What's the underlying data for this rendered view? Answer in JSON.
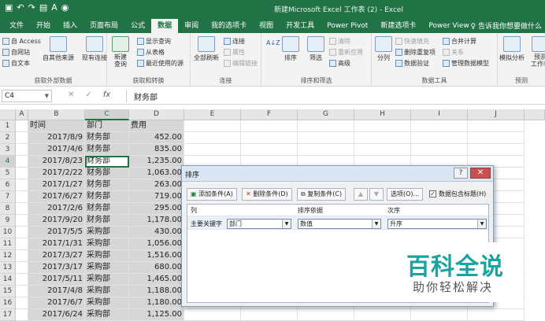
{
  "window": {
    "title": "新建Microsoft Excel 工作表 (2)  -  Excel",
    "qat_icons": [
      "save-icon",
      "undo-icon",
      "redo-icon",
      "print-preview-icon",
      "font-icon",
      "camera-icon"
    ]
  },
  "tabs": [
    {
      "label": "文件"
    },
    {
      "label": "开始"
    },
    {
      "label": "插入"
    },
    {
      "label": "页面布局"
    },
    {
      "label": "公式"
    },
    {
      "label": "数据",
      "active": true
    },
    {
      "label": "审阅"
    },
    {
      "label": "我的选项卡"
    },
    {
      "label": "视图"
    },
    {
      "label": "开发工具"
    },
    {
      "label": "Power Pivot"
    },
    {
      "label": "新建选项卡"
    },
    {
      "label": "Power View"
    }
  ],
  "tell_me": "♀ 告诉我你想要做什么",
  "ribbon": {
    "get_external": {
      "label": "获取外部数据",
      "items": [
        "自 Access",
        "自网站",
        "自文本",
        "自其他来源",
        "现有连接"
      ]
    },
    "get_transform": {
      "label": "获取和转换",
      "new_query": "新建\n查询",
      "items": [
        "显示查询",
        "从表格",
        "最近使用的源"
      ]
    },
    "connections": {
      "label": "连接",
      "refresh_all": "全部刷新",
      "items": [
        "连接",
        "属性",
        "编辑链接"
      ]
    },
    "sort_filter": {
      "label": "排序和筛选",
      "sort_az": "A↓Z",
      "sort": "排序",
      "filter": "筛选",
      "items": [
        "清除",
        "重新应用",
        "高级"
      ]
    },
    "data_tools": {
      "label": "数据工具",
      "split": "分列",
      "items": [
        "快速填充",
        "删除重复项",
        "数据验证",
        "合并计算",
        "关系",
        "管理数据模型"
      ]
    },
    "forecast": {
      "label": "预测",
      "items": [
        "模拟分析",
        "预测\n工作表"
      ]
    }
  },
  "formula_bar": {
    "name_box": "C4",
    "buttons": [
      "✕",
      "✓",
      "fx"
    ],
    "content": "财务部"
  },
  "grid": {
    "columns": [
      "A",
      "B",
      "C",
      "D",
      "E",
      "F",
      "G",
      "H",
      "I",
      "J"
    ],
    "rows": [
      {
        "num": "1",
        "b": "时间",
        "c": "部门",
        "d": "费用"
      },
      {
        "num": "2",
        "b": "2017/8/9",
        "c": "财务部",
        "d": "452.00"
      },
      {
        "num": "3",
        "b": "2017/4/6",
        "c": "财务部",
        "d": "835.00"
      },
      {
        "num": "4",
        "b": "2017/8/23",
        "c": "财务部",
        "d": "1,235.00"
      },
      {
        "num": "5",
        "b": "2017/2/22",
        "c": "财务部",
        "d": "1,063.00"
      },
      {
        "num": "6",
        "b": "2017/1/27",
        "c": "财务部",
        "d": "263.00"
      },
      {
        "num": "7",
        "b": "2017/6/27",
        "c": "财务部",
        "d": "719.00"
      },
      {
        "num": "8",
        "b": "2017/2/6",
        "c": "财务部",
        "d": "295.00"
      },
      {
        "num": "9",
        "b": "2017/9/20",
        "c": "财务部",
        "d": "1,178.00"
      },
      {
        "num": "10",
        "b": "2017/5/5",
        "c": "采购部",
        "d": "430.00"
      },
      {
        "num": "11",
        "b": "2017/1/31",
        "c": "采购部",
        "d": "1,056.00"
      },
      {
        "num": "12",
        "b": "2017/3/27",
        "c": "采购部",
        "d": "1,516.00"
      },
      {
        "num": "13",
        "b": "2017/3/17",
        "c": "采购部",
        "d": "680.00"
      },
      {
        "num": "14",
        "b": "2017/5/11",
        "c": "采购部",
        "d": "1,465.00"
      },
      {
        "num": "15",
        "b": "2017/4/8",
        "c": "采购部",
        "d": "1,188.00"
      },
      {
        "num": "16",
        "b": "2017/6/7",
        "c": "采购部",
        "d": "1,180.00"
      },
      {
        "num": "17",
        "b": "2017/6/24",
        "c": "采购部",
        "d": "1,125.00"
      }
    ]
  },
  "sort_dialog": {
    "title": "排序",
    "help": "?",
    "close": "✕",
    "buttons": {
      "add_level": "添加条件(A)",
      "delete_level": "删除条件(D)",
      "copy_level": "复制条件(C)",
      "options": "选项(O)..."
    },
    "has_headers": "数据包含标题(H)",
    "headers": {
      "column": "列",
      "sort_on": "排序依据",
      "order": "次序"
    },
    "row": {
      "label": "主要关键字",
      "column": "部门",
      "sort_on": "数值",
      "order": "升序"
    }
  },
  "watermark": {
    "main": "百科全说",
    "sub": "助你轻松解决"
  },
  "colors": {
    "excel_green": "#217346",
    "selection_gray": "#d6d6d6",
    "watermark_teal": "#1aa3a0"
  }
}
